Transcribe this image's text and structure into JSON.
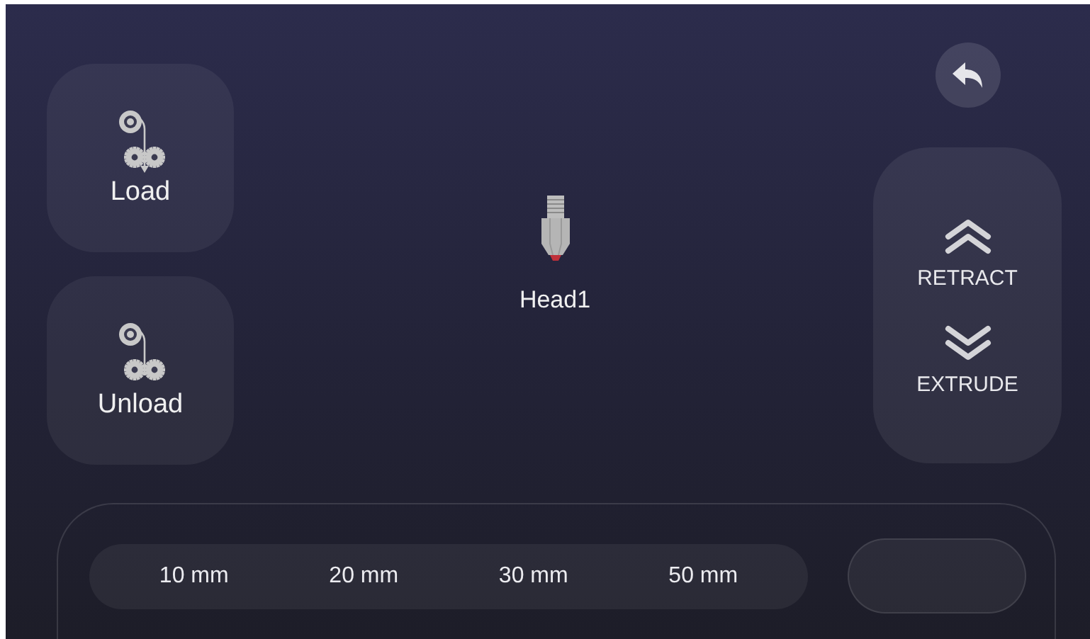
{
  "filament_buttons": [
    {
      "kind": "load",
      "label": "Load"
    },
    {
      "kind": "unload",
      "label": "Unload"
    }
  ],
  "head": {
    "label": "Head1"
  },
  "move_buttons": [
    {
      "kind": "retract",
      "label": "RETRACT"
    },
    {
      "kind": "extrude",
      "label": "EXTRUDE"
    }
  ],
  "distances": [
    "10 mm",
    "20 mm",
    "30 mm",
    "50 mm"
  ]
}
